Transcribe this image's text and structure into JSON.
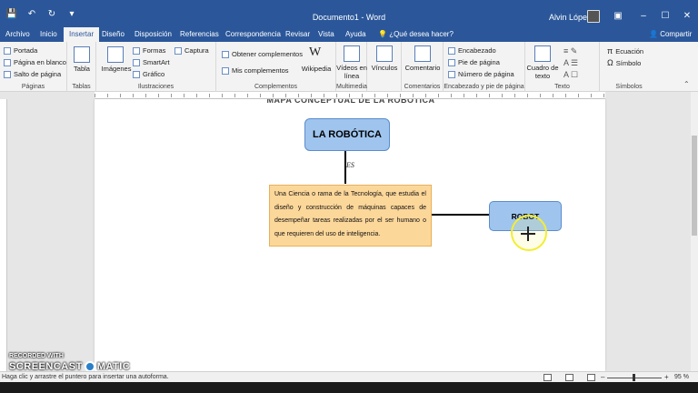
{
  "titlebar": {
    "doc_title": "Documento1 - Word",
    "user_name": "Alvin López",
    "qat": [
      "save-icon",
      "undo-icon",
      "redo-icon",
      "customize-icon"
    ]
  },
  "tabs": [
    "Archivo",
    "Inicio",
    "Insertar",
    "Diseño",
    "Disposición",
    "Referencias",
    "Correspondencia",
    "Revisar",
    "Vista",
    "Ayuda"
  ],
  "active_tab": "Insertar",
  "tell_me": "¿Qué desea hacer?",
  "share": "Compartir",
  "ribbon": {
    "paginas": {
      "label": "Páginas",
      "items": [
        "Portada",
        "Página en blanco",
        "Salto de página"
      ]
    },
    "tablas": {
      "label": "Tablas",
      "items": [
        "Tabla"
      ]
    },
    "ilustraciones": {
      "label": "Ilustraciones",
      "items": [
        "Imágenes",
        "Formas",
        "SmartArt",
        "Gráfico",
        "Captura"
      ]
    },
    "complementos": {
      "label": "Complementos",
      "items": [
        "Obtener complementos",
        "Mis complementos",
        "Wikipedia"
      ]
    },
    "multimedia": {
      "label": "Multimedia",
      "items": [
        "Vídeos en línea"
      ]
    },
    "vinculos": {
      "label": "",
      "items": [
        "Vínculos"
      ]
    },
    "comentarios": {
      "label": "Comentarios",
      "items": [
        "Comentario"
      ]
    },
    "encabezado": {
      "label": "Encabezado y pie de página",
      "items": [
        "Encabezado",
        "Pie de página",
        "Número de página"
      ]
    },
    "texto": {
      "label": "Texto",
      "items": [
        "Cuadro de texto"
      ]
    },
    "simbolos": {
      "label": "Símbolos",
      "items": [
        "Ecuación",
        "Símbolo"
      ]
    }
  },
  "document": {
    "heading": "MAPA CONCEPTUAL DE LA ROBÓTICA",
    "main_node": "LA ROBÓTICA",
    "connector_label": "ES",
    "definition": "Una Ciencia o rama de la Tecnología, que estudia el diseño y construcción de máquinas capaces de desempeñar tareas realizadas por el ser humano o que requieren del uso de inteligencia.",
    "robot_node": "ROBOT"
  },
  "watermark": {
    "line1": "RECORDED WITH",
    "line2a": "SCREENCAST",
    "line2b": "MATIC"
  },
  "status": {
    "text": "Haga clic y arrastre el puntero para insertar una autoforma.",
    "zoom": "95 %",
    "zoom_level": 0.95
  },
  "colors": {
    "ribbon_blue": "#2b579a",
    "node_blue": "#9fc5ee",
    "node_orange": "#fcd79a",
    "cursor_highlight": "#f3ee32"
  }
}
